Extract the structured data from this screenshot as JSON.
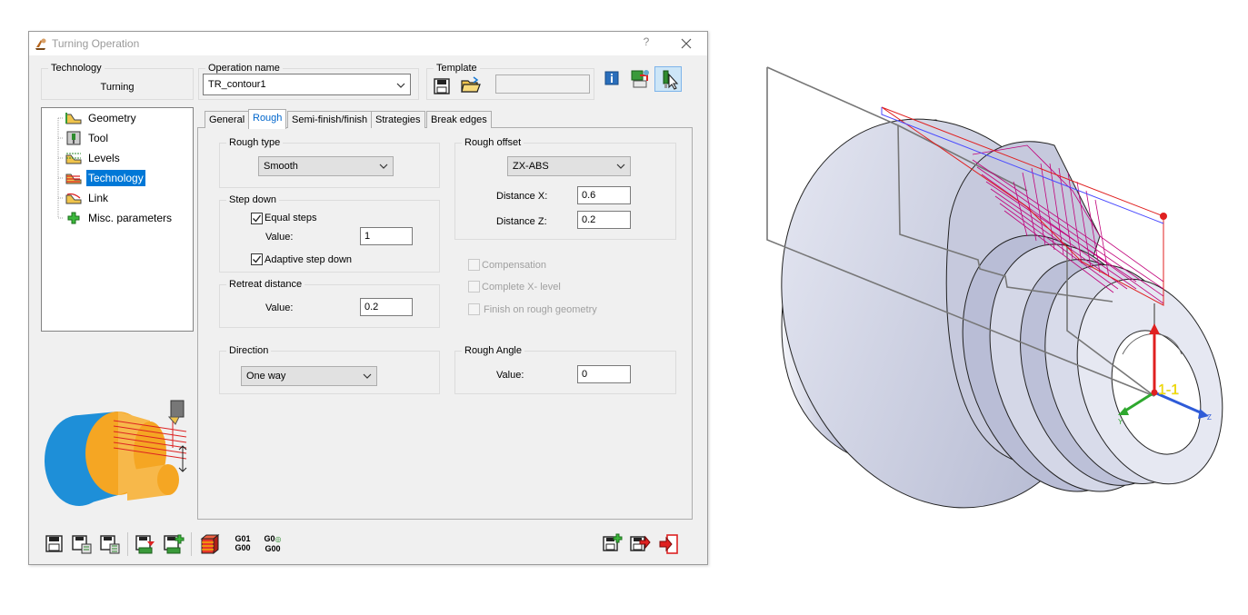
{
  "window": {
    "title": "Turning Operation",
    "help": "?"
  },
  "technology_group": {
    "label": "Technology",
    "value": "Turning"
  },
  "operation_name": {
    "label": "Operation name",
    "value": "TR_contour1"
  },
  "template": {
    "label": "Template",
    "value": ""
  },
  "tree": {
    "items": [
      {
        "label": "Geometry",
        "icon": "geometry-icon"
      },
      {
        "label": "Tool",
        "icon": "tool-icon"
      },
      {
        "label": "Levels",
        "icon": "levels-icon"
      },
      {
        "label": "Technology",
        "icon": "technology-icon",
        "selected": true
      },
      {
        "label": "Link",
        "icon": "link-icon"
      },
      {
        "label": "Misc. parameters",
        "icon": "plus-icon"
      }
    ]
  },
  "tabs": [
    {
      "label": "General"
    },
    {
      "label": "Rough",
      "active": true
    },
    {
      "label": "Semi-finish/finish"
    },
    {
      "label": "Strategies"
    },
    {
      "label": "Break edges"
    }
  ],
  "rough": {
    "rough_type": {
      "label": "Rough type",
      "value": "Smooth"
    },
    "step_down": {
      "label": "Step down",
      "equal_steps": {
        "label": "Equal steps",
        "checked": true
      },
      "value_label": "Value:",
      "value": "1",
      "adaptive": {
        "label": "Adaptive step down",
        "checked": true
      }
    },
    "retreat": {
      "label": "Retreat distance",
      "value_label": "Value:",
      "value": "0.2"
    },
    "direction": {
      "label": "Direction",
      "value": "One way"
    },
    "rough_offset": {
      "label": "Rough offset",
      "mode": "ZX-ABS",
      "dx_label": "Distance X:",
      "dx": "0.6",
      "dz_label": "Distance Z:",
      "dz": "0.2"
    },
    "compensation": {
      "label": "Compensation",
      "checked": false,
      "disabled": true
    },
    "complete_x": {
      "label": "Complete X- level",
      "checked": false,
      "disabled": true
    },
    "finish_rough": {
      "label": "Finish on rough geometry",
      "checked": false,
      "disabled": true
    },
    "rough_angle": {
      "label": "Rough Angle",
      "value_label": "Value:",
      "value": "0"
    }
  },
  "bottom_toolbar": {
    "gcode_a_top": "G01",
    "gcode_a_bottom": "G00",
    "gcode_b_top": "G0",
    "gcode_b_bottom": "G00"
  },
  "viewport": {
    "cs_label": "1-1",
    "axis_y": "Y",
    "axis_z": "Z"
  },
  "colors": {
    "selection": "#0078d7",
    "active_tab_text": "#0066cc",
    "toolpath": "#c0007a",
    "part": "#c8cce0"
  }
}
